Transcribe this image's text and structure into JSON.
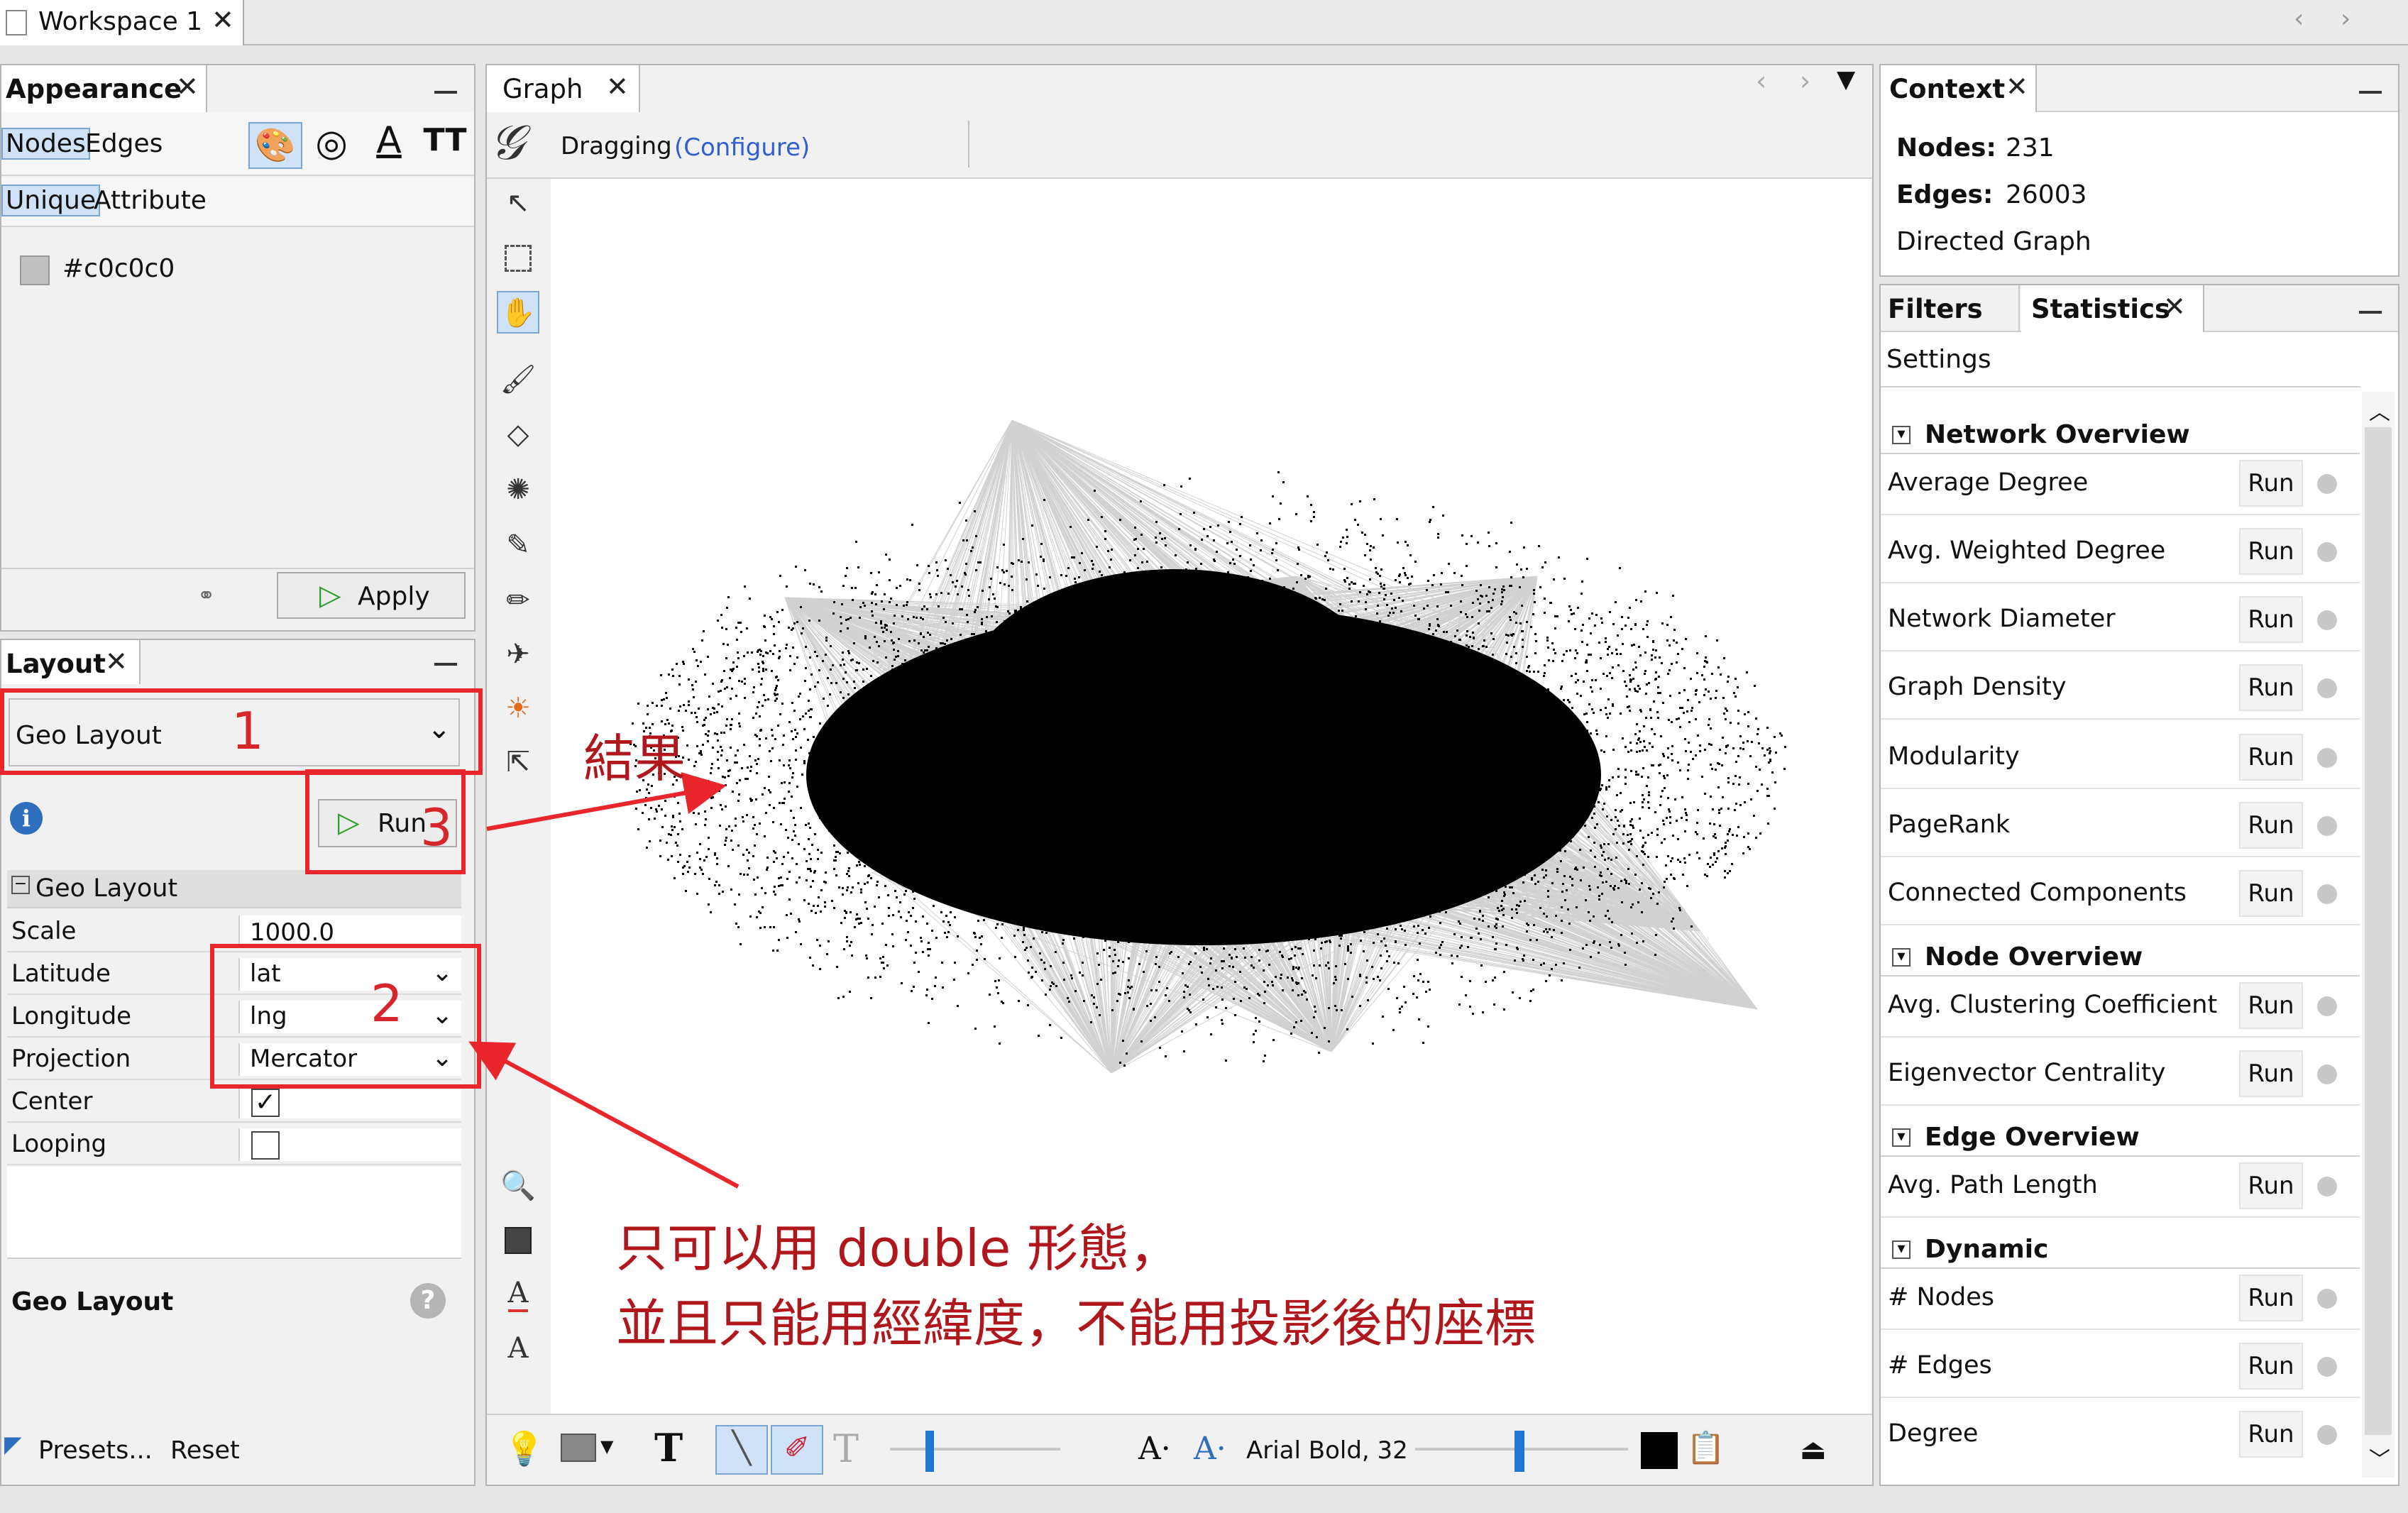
{
  "window": {
    "tab_title": "Workspace 1",
    "close": "✕"
  },
  "appearance": {
    "title": "Appearance",
    "tabs": [
      "Nodes",
      "Edges"
    ],
    "subtabs": [
      "Unique",
      "Attribute"
    ],
    "color_value": "#c0c0c0",
    "apply_label": "Apply"
  },
  "layout": {
    "title": "Layout",
    "selected_layout": "Geo Layout",
    "run_label": "Run",
    "section_title": "Geo Layout",
    "properties": [
      {
        "name": "Scale",
        "value": "1000.0"
      },
      {
        "name": "Latitude",
        "value": "lat"
      },
      {
        "name": "Longitude",
        "value": "lng"
      },
      {
        "name": "Projection",
        "value": "Mercator"
      },
      {
        "name": "Center",
        "value": ""
      },
      {
        "name": "Looping",
        "value": ""
      }
    ],
    "center_checked": true,
    "looping_checked": false,
    "description_title": "Geo Layout",
    "presets_label": "Presets...",
    "reset_label": "Reset"
  },
  "graph": {
    "title": "Graph",
    "mode_label": "Dragging",
    "configure_label": "(Configure)",
    "font_label": "Arial Bold, 32"
  },
  "context": {
    "title": "Context",
    "nodes_label": "Nodes:",
    "nodes_value": "231",
    "edges_label": "Edges:",
    "edges_value": "26003",
    "graph_type": "Directed Graph"
  },
  "statistics": {
    "tabs": [
      "Filters",
      "Statistics"
    ],
    "settings_label": "Settings",
    "run_label": "Run",
    "sections": [
      {
        "title": "Network Overview",
        "items": [
          "Average Degree",
          "Avg. Weighted Degree",
          "Network Diameter",
          "Graph Density",
          "Modularity",
          "PageRank",
          "Connected Components"
        ]
      },
      {
        "title": "Node Overview",
        "items": [
          "Avg. Clustering Coefficient",
          "Eigenvector Centrality"
        ]
      },
      {
        "title": "Edge Overview",
        "items": [
          "Avg. Path Length"
        ]
      },
      {
        "title": "Dynamic",
        "items": [
          "# Nodes",
          "# Edges",
          "Degree"
        ]
      }
    ]
  },
  "annotations": {
    "step1": "1",
    "step2": "2",
    "step3": "3",
    "result_label": "結果",
    "note_line1": "只可以用 double 形態，",
    "note_line2": "並且只能用經緯度，不能用投影後的座標",
    "accent_color": "#e8262b",
    "text_color": "#b0171d"
  }
}
